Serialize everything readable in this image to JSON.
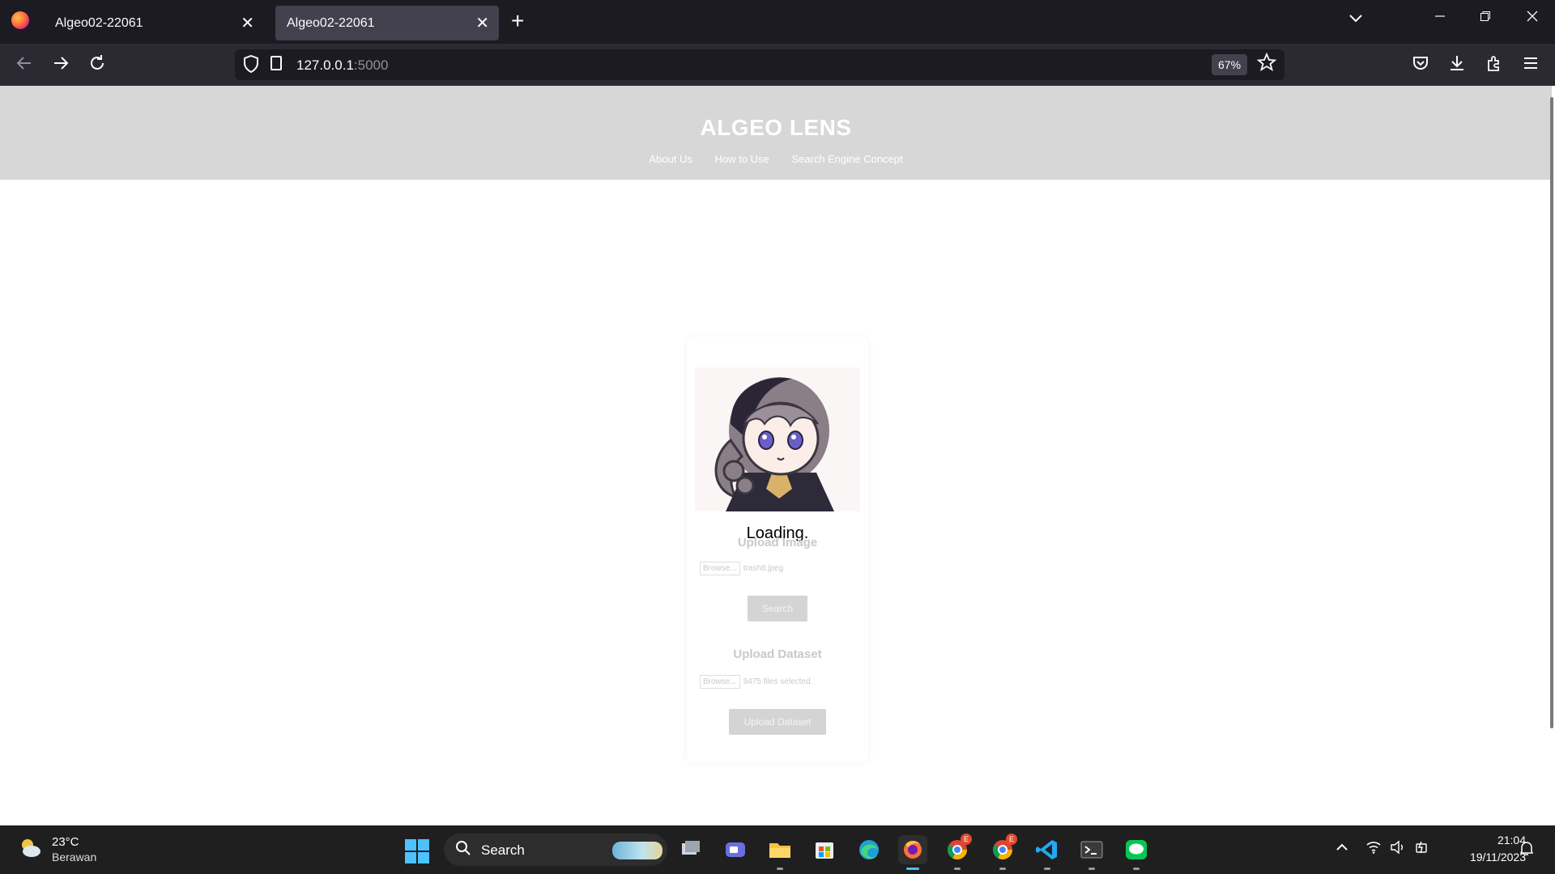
{
  "browser": {
    "tabs": [
      {
        "title": "Algeo02-22061",
        "active": false
      },
      {
        "title": "Algeo02-22061",
        "active": true
      }
    ],
    "new_tab_glyph": "+",
    "close_glyph": "✕",
    "url_host": "127.0.0.1",
    "url_port": ":5000",
    "zoom": "67%"
  },
  "page": {
    "brand": "ALGEO LENS",
    "menu": [
      "About Us",
      "How to Use",
      "Search Engine Concept"
    ],
    "loading_text": "Loading.",
    "upload_image": {
      "title": "Upload Image",
      "browse_label": "Browse...",
      "file_name": "trash8.jpeg",
      "search_button": "Search"
    },
    "upload_dataset": {
      "title": "Upload Dataset",
      "browse_label": "Browse...",
      "file_status": "9475 files selected.",
      "upload_button": "Upload Dataset"
    }
  },
  "taskbar": {
    "weather_temp": "23°C",
    "weather_desc": "Berawan",
    "search_label": "Search",
    "chrome_badge_1": "E",
    "chrome_badge_2": "E",
    "clock_time": "21:04",
    "clock_date": "19/11/2023"
  },
  "colors": {
    "accent": "#4cc2ff",
    "header_bg": "#d7d7d7",
    "tab_bar_bg": "#1c1b22"
  }
}
